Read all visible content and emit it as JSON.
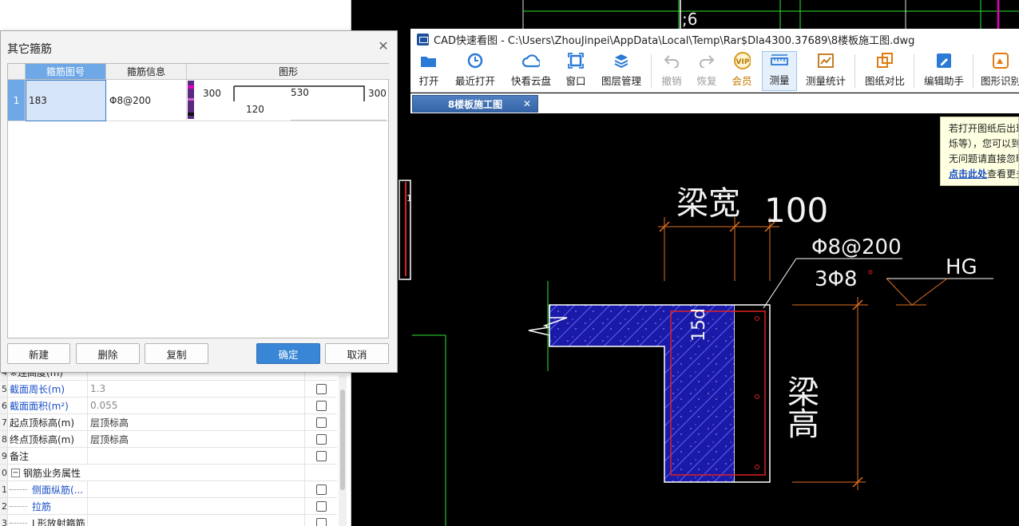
{
  "cad": {
    "window_title": "CAD快速看图 - C:\\Users\\ZhouJinpei\\AppData\\Local\\Temp\\Rar$DIa4300.37689\\8楼板施工图.dwg",
    "toolbar": [
      {
        "label": "打开",
        "icon": "folder-open-icon"
      },
      {
        "label": "最近打开",
        "icon": "clock-icon"
      },
      {
        "label": "快看云盘",
        "icon": "cloud-icon"
      },
      {
        "label": "窗口",
        "icon": "window-icon"
      },
      {
        "label": "图层管理",
        "icon": "layers-icon"
      },
      {
        "label": "撤销",
        "icon": "undo-icon"
      },
      {
        "label": "恢复",
        "icon": "redo-icon"
      },
      {
        "label": "会员",
        "icon": "vip-icon",
        "icon_text": "VIP"
      },
      {
        "label": "测量",
        "icon": "ruler-icon"
      },
      {
        "label": "测量统计",
        "icon": "chart-icon"
      },
      {
        "label": "图纸对比",
        "icon": "compare-icon"
      },
      {
        "label": "编辑助手",
        "icon": "edit-icon"
      },
      {
        "label": "图形识别",
        "icon": "shape-recognize-icon"
      }
    ],
    "tab_label": "8楼板施工图",
    "hint_line1": "若打开图纸后出现",
    "hint_line2": "烁等），您可以到",
    "hint_line3": "无问题请直接忽略",
    "hint_link": "点击此处",
    "hint_suffix": "查看更多",
    "drawing": {
      "top_text": ";6",
      "beam_width_label": "梁宽",
      "beam_width_value": "100",
      "stirrup_label": "Φ8@200",
      "longitudinal_label": "3Φ8",
      "hg_label": "HG",
      "anchor_label": "15d",
      "beam_height_label": "梁高",
      "left_marker": "1"
    },
    "colors": {
      "hatch_blue": "#1a1aa8",
      "dim_orange": "#e07020",
      "rebar_red": "#e02020",
      "line_green": "#2ee82e",
      "line_white": "#ffffff",
      "accent_magenta": "#e000c0"
    }
  },
  "dialog": {
    "title": "其它箍筋",
    "columns": [
      "箍筋图号",
      "箍筋信息",
      "图形"
    ],
    "rows": [
      {
        "index": "1",
        "shape_no": "183",
        "info": "Φ8@200",
        "shape_left": "300",
        "shape_mid": "530",
        "shape_right": "300",
        "shape_bottom": "120"
      }
    ],
    "buttons": {
      "new": "新建",
      "delete": "删除",
      "copy": "复制",
      "ok": "确定",
      "cancel": "取消"
    }
  },
  "properties": {
    "rows": [
      {
        "num": "4",
        "name": "※连高度(m)",
        "value": "",
        "blue": false,
        "check": false
      },
      {
        "num": "5",
        "name": "截面周长(m)",
        "value": "1.3",
        "blue": true,
        "check": true
      },
      {
        "num": "6",
        "name": "截面面积(m²)",
        "value": "0.055",
        "blue": true,
        "check": true
      },
      {
        "num": "7",
        "name": "起点顶标高(m)",
        "value": "层顶标高",
        "blue": false,
        "check": true
      },
      {
        "num": "8",
        "name": "终点顶标高(m)",
        "value": "层顶标高",
        "blue": false,
        "check": true
      },
      {
        "num": "9",
        "name": "备注",
        "value": "",
        "blue": false,
        "check": true
      },
      {
        "num": "0",
        "name": "钢筋业务属性",
        "value": "",
        "blue": false,
        "check": false,
        "group": true
      },
      {
        "num": "1",
        "name": "侧面纵筋(...",
        "value": "",
        "blue": true,
        "check": true,
        "child": true
      },
      {
        "num": "2",
        "name": "拉筋",
        "value": "",
        "blue": true,
        "check": true,
        "child": true
      },
      {
        "num": "3",
        "name": "L形放射箍筋",
        "value": "",
        "blue": false,
        "check": true,
        "child": true
      }
    ],
    "expander_symbol": "−"
  }
}
